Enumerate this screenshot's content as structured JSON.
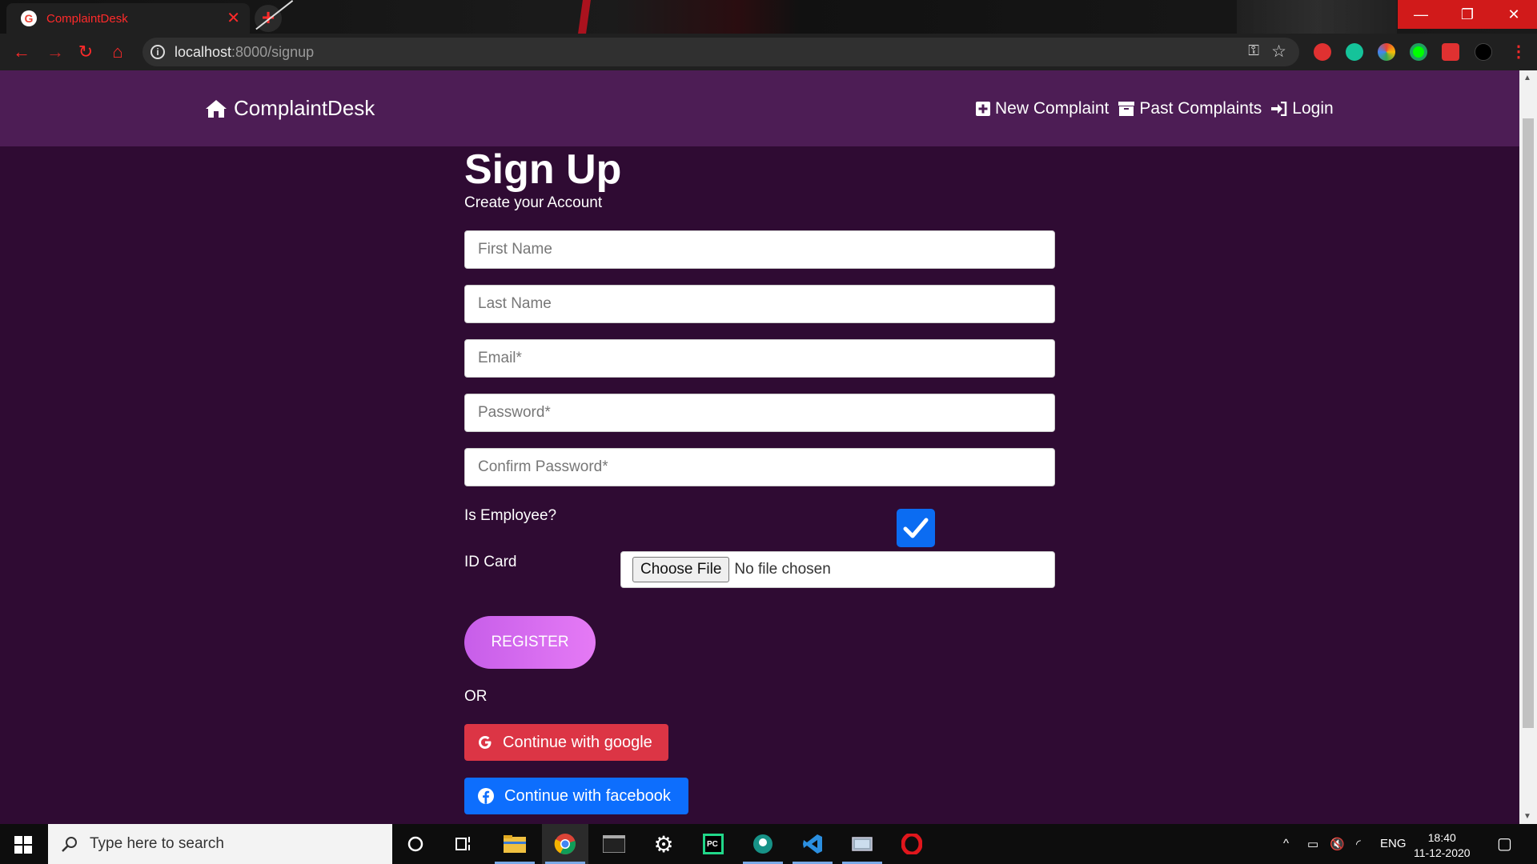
{
  "browser": {
    "tab_title": "ComplaintDesk",
    "url_host": "localhost",
    "url_rest": ":8000/signup"
  },
  "nav": {
    "brand": "ComplaintDesk",
    "links": [
      {
        "label": "New Complaint",
        "icon": "plus-square-icon"
      },
      {
        "label": "Past Complaints",
        "icon": "archive-icon"
      },
      {
        "label": "Login",
        "icon": "sign-in-icon"
      }
    ]
  },
  "form": {
    "title": "Sign Up",
    "subtitle": "Create your Account",
    "first_name_placeholder": "First Name",
    "last_name_placeholder": "Last Name",
    "email_placeholder": "Email*",
    "password_placeholder": "Password*",
    "confirm_password_placeholder": "Confirm Password*",
    "is_employee_label": "Is Employee?",
    "is_employee_checked": true,
    "id_card_label": "ID Card",
    "choose_file_label": "Choose File",
    "no_file_text": "No file chosen",
    "register_label": "REGISTER",
    "or_text": "OR",
    "google_label": "Continue with google",
    "facebook_label": "Continue with facebook"
  },
  "taskbar": {
    "search_placeholder": "Type here to search",
    "language": "ENG",
    "time": "18:40",
    "date": "11-12-2020"
  },
  "colors": {
    "page_bg": "#2f0b33",
    "navbar_bg": "#4d1d55",
    "checkbox": "#0b6cf2",
    "google": "#dc3545",
    "facebook": "#0d6efd",
    "register_gradient_start": "#c75ee9",
    "register_gradient_end": "#e57af5"
  }
}
